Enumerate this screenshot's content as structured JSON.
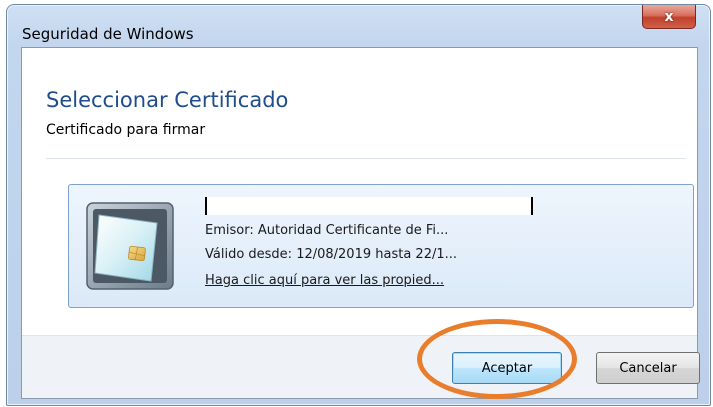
{
  "window": {
    "title": "Seguridad de Windows",
    "close_glyph": "x"
  },
  "dialog": {
    "heading": "Seleccionar Certificado",
    "subheading": "Certificado para firmar"
  },
  "certificate": {
    "icon": "smart-card-icon",
    "issuer": "Emisor: Autoridad Certificante de Fi...",
    "validity": "Válido desde: 12/08/2019 hasta 22/1...",
    "properties_link": "Haga clic aquí para ver las propied..."
  },
  "buttons": {
    "accept": "Aceptar",
    "cancel": "Cancelar"
  },
  "colors": {
    "heading_blue": "#1e4c8c",
    "highlight_orange": "#ea7d2b",
    "close_red": "#c1412c"
  }
}
